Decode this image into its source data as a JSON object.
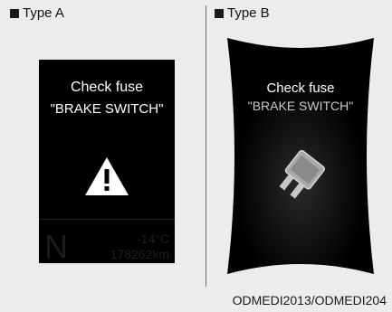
{
  "type_a": {
    "label": "Type A",
    "message_line1": "Check fuse",
    "message_line2": "\"BRAKE SWITCH\"",
    "gear": "N",
    "temperature": "-14°C",
    "odometer": "178262km"
  },
  "type_b": {
    "label": "Type B",
    "message_line1": "Check fuse",
    "message_line2": "\"BRAKE SWITCH\""
  },
  "caption": "ODMEDI2013/ODMEDI204",
  "icons": {
    "type_a_warning": "warning-triangle-icon",
    "type_b_fuse": "fuse-icon"
  },
  "colors": {
    "background": "#ececec",
    "cluster": "#000000",
    "text": "#ffffff"
  }
}
